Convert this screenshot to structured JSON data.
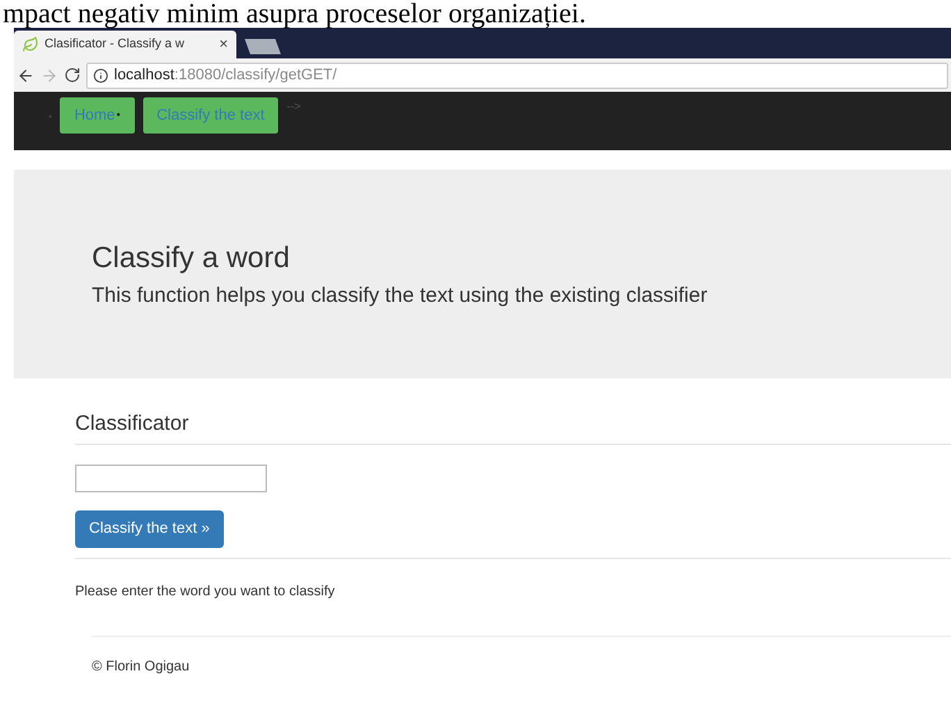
{
  "document_text": "mpact negativ minim asupra proceselor organizației.",
  "browser": {
    "tab_title": "Clasificator - Classify a w",
    "tab_close": "×",
    "url_host": "localhost",
    "url_path": ":18080/classify/getGET/"
  },
  "navbar": {
    "lead_bullet": "•",
    "items": [
      {
        "label": "Home",
        "bullet": "•"
      },
      {
        "label": "Classify the text"
      }
    ],
    "trailing": "-->"
  },
  "jumbotron": {
    "title": "Classify a word",
    "subtitle": "This function helps you classify the text using the existing classifier"
  },
  "form": {
    "heading": "Classificator",
    "button": "Classify the text »",
    "message": "Please enter the word you want to classify"
  },
  "footer": "© Florin Ogigau"
}
